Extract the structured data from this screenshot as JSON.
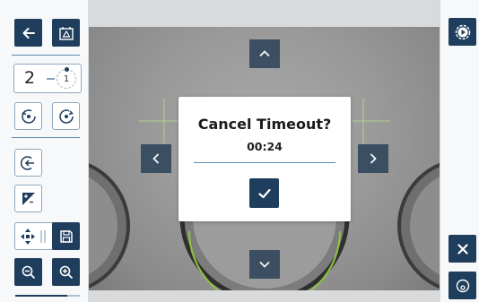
{
  "toolbar": {
    "counter": {
      "value": "2",
      "dial_value": "1"
    },
    "slider_progress": 0.8
  },
  "dialog": {
    "title": "Cancel Timeout?",
    "timer": "00:24"
  },
  "colors": {
    "navy": "#1f3d5c",
    "outline": "#8fa7bd",
    "crosshair": "#b7d98a",
    "well_ring": "#8cc63f"
  },
  "icons": {
    "back": "arrow-left-icon",
    "capture": "camera-frame-icon",
    "rotate_left": "rotate-ccw-icon",
    "rotate_right": "rotate-cw-icon",
    "enter_exit": "arrow-in-circle-icon",
    "exposure": "exposure-icon",
    "pan": "four-way-arrows-icon",
    "save": "floppy-disk-icon",
    "zoom_out": "zoom-out-icon",
    "zoom_in": "zoom-in-icon",
    "play": "play-gear-icon",
    "close": "close-icon",
    "focus": "focus-target-icon"
  }
}
